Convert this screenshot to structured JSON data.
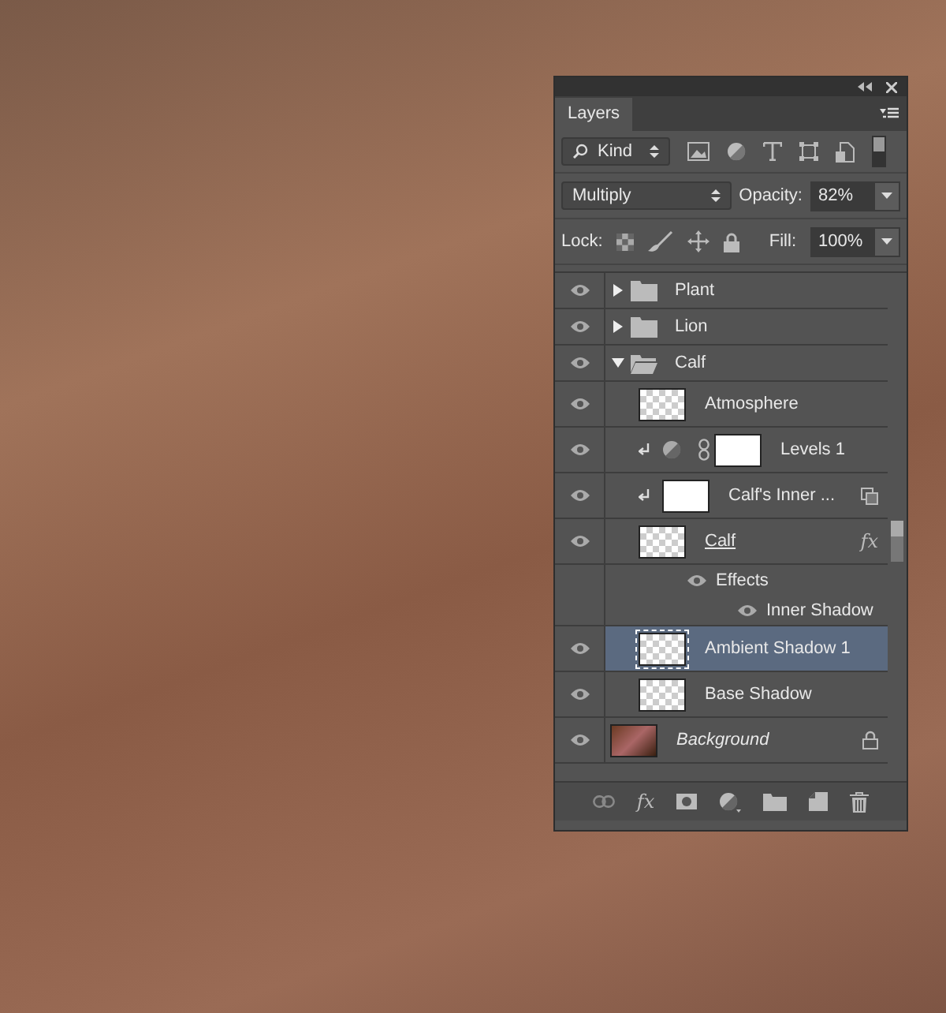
{
  "panel": {
    "tab": "Layers",
    "filter": {
      "value": "Kind"
    },
    "blend_mode": {
      "value": "Multiply"
    },
    "opacity": {
      "label": "Opacity:",
      "value": "82%"
    },
    "lock": {
      "label": "Lock:"
    },
    "fill": {
      "label": "Fill:",
      "value": "100%"
    }
  },
  "layers": [
    {
      "kind": "group",
      "name": "Plant",
      "visible": true,
      "selected": false,
      "expanded": false
    },
    {
      "kind": "group",
      "name": "Lion",
      "visible": true,
      "selected": false,
      "expanded": false
    },
    {
      "kind": "group",
      "name": "Calf",
      "visible": true,
      "selected": false,
      "expanded": true,
      "children": [
        {
          "kind": "pixel",
          "name": "Atmosphere",
          "visible": true,
          "selected": false,
          "clipped": false
        },
        {
          "kind": "adjustment",
          "name": "Levels 1",
          "visible": true,
          "selected": false,
          "clipped": true
        },
        {
          "kind": "smart",
          "name": "Calf's Inner ...",
          "visible": true,
          "selected": false,
          "clipped": true
        },
        {
          "kind": "pixel",
          "name": "Calf",
          "visible": true,
          "selected": false,
          "clipped": false,
          "fx": "fx",
          "effects": {
            "label": "Effects",
            "visible": true,
            "items": [
              {
                "name": "Inner Shadow",
                "visible": true
              }
            ]
          }
        },
        {
          "kind": "pixel",
          "name": "Ambient Shadow 1",
          "visible": true,
          "selected": true,
          "clipped": false
        },
        {
          "kind": "pixel",
          "name": "Base Shadow",
          "visible": true,
          "selected": false,
          "clipped": false
        }
      ]
    },
    {
      "kind": "background",
      "name": "Background",
      "visible": true,
      "selected": false,
      "locked": true
    }
  ],
  "footer": {
    "style_button": "fx"
  }
}
